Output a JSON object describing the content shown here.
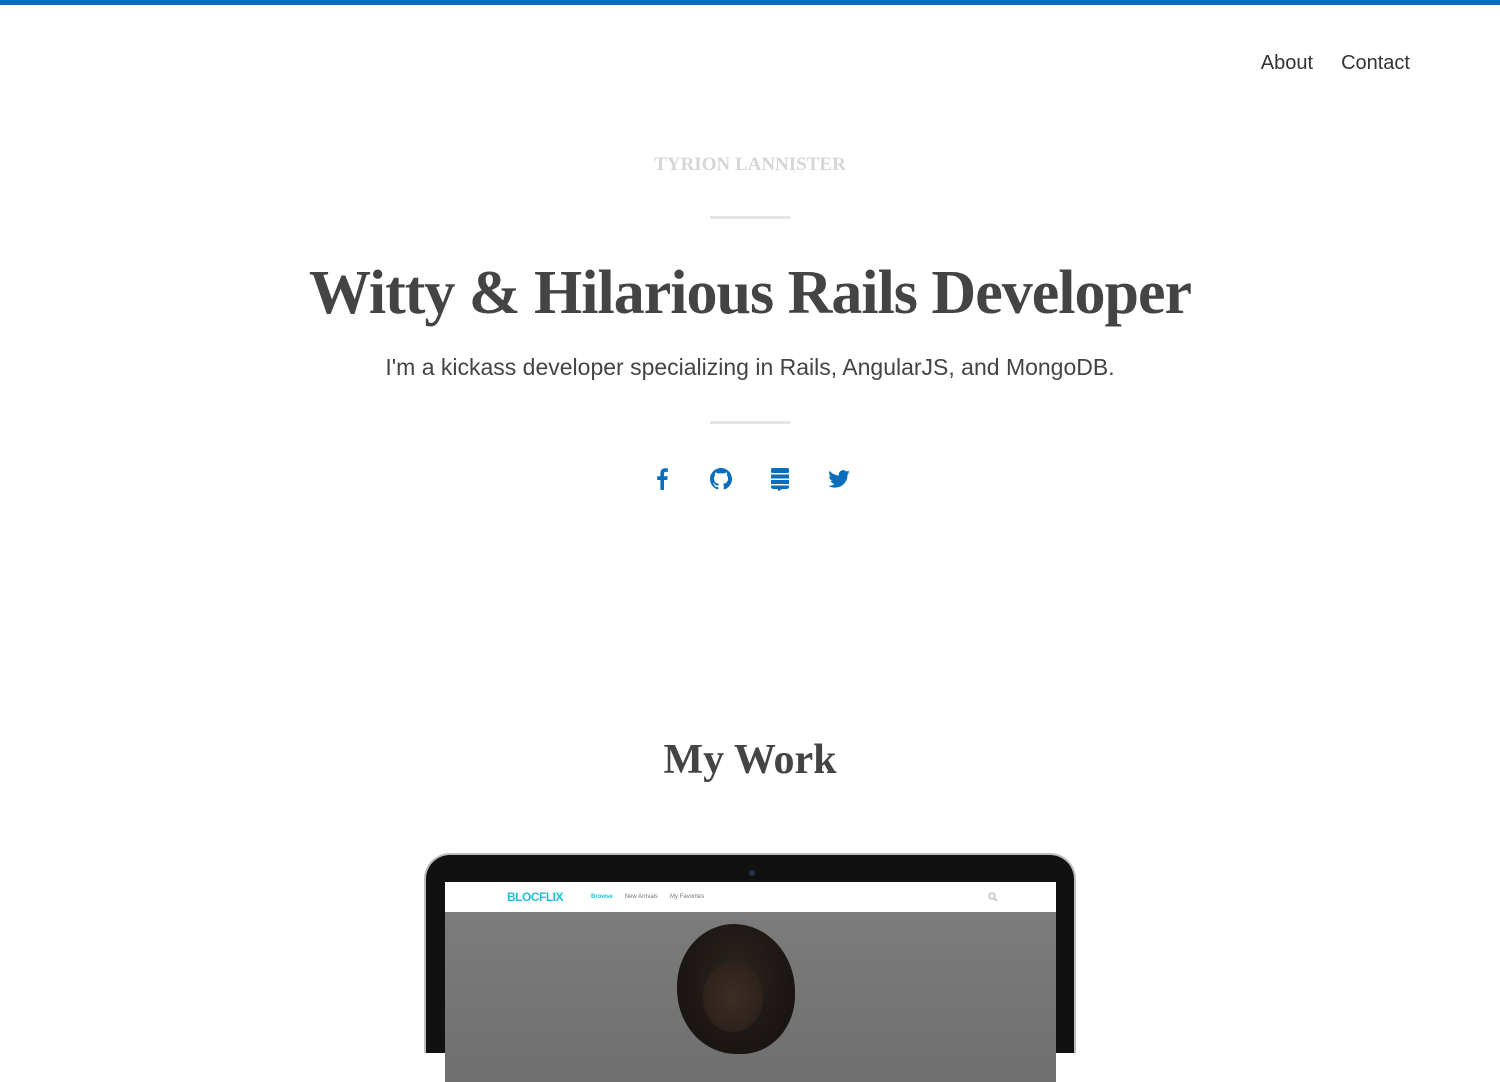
{
  "nav": {
    "items": [
      {
        "label": "About"
      },
      {
        "label": "Contact"
      }
    ]
  },
  "hero": {
    "kicker": "TYRION LANNISTER",
    "headline": "Witty & Hilarious Rails Developer",
    "subheadline": "I'm a kickass developer specializing in Rails, AngularJS, and MongoDB."
  },
  "social": [
    {
      "icon": "facebook-icon"
    },
    {
      "icon": "github-icon"
    },
    {
      "icon": "stack-exchange-icon"
    },
    {
      "icon": "twitter-icon"
    }
  ],
  "work": {
    "title": "My Work",
    "preview": {
      "logo": "BLOCFLIX",
      "links": [
        "Browse",
        "New Arrivals",
        "My Favorites"
      ]
    }
  },
  "colors": {
    "accent": "#0a6ebd",
    "heading": "#444444",
    "kicker": "#d6d6d6",
    "preview_brand": "#1ec1d8"
  }
}
